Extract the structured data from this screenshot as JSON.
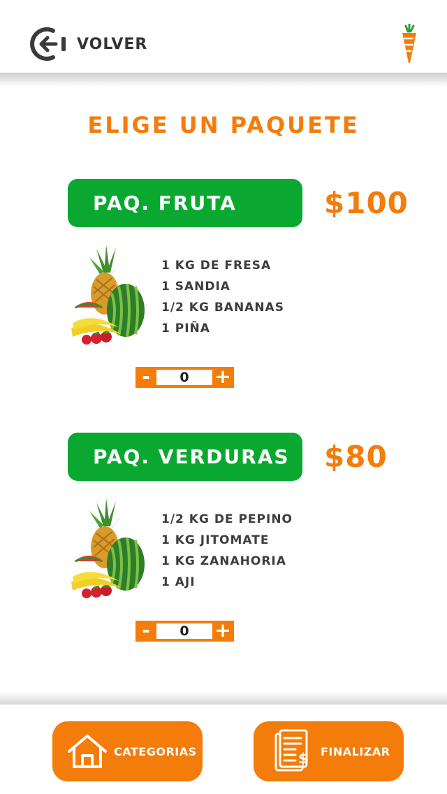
{
  "header": {
    "back_label": "VOLVER"
  },
  "page_title": "ELIGE UN PAQUETE",
  "packages": [
    {
      "name": "PAQ. FRUTA",
      "price": "$100",
      "items": [
        "1 KG DE FRESA",
        "1 SANDIA",
        "1/2 KG  BANANAS",
        "1 PIÑA"
      ],
      "quantity": "0"
    },
    {
      "name": "PAQ. VERDURAS",
      "price": "$80",
      "items": [
        "1/2 KG DE PEPINO",
        "1 KG JITOMATE",
        "1 KG ZANAHORIA",
        "1 AJI"
      ],
      "quantity": "0"
    }
  ],
  "stepper": {
    "minus": "-",
    "plus": "+"
  },
  "footer": {
    "categories_label": "CATEGORIAS",
    "finish_label": "FINALIZAR"
  },
  "colors": {
    "accent": "#f47c0b",
    "green": "#0aa831"
  },
  "icons": [
    "back-arrow-icon",
    "carrot-logo-icon",
    "fruit-image",
    "home-icon",
    "invoice-icon"
  ]
}
